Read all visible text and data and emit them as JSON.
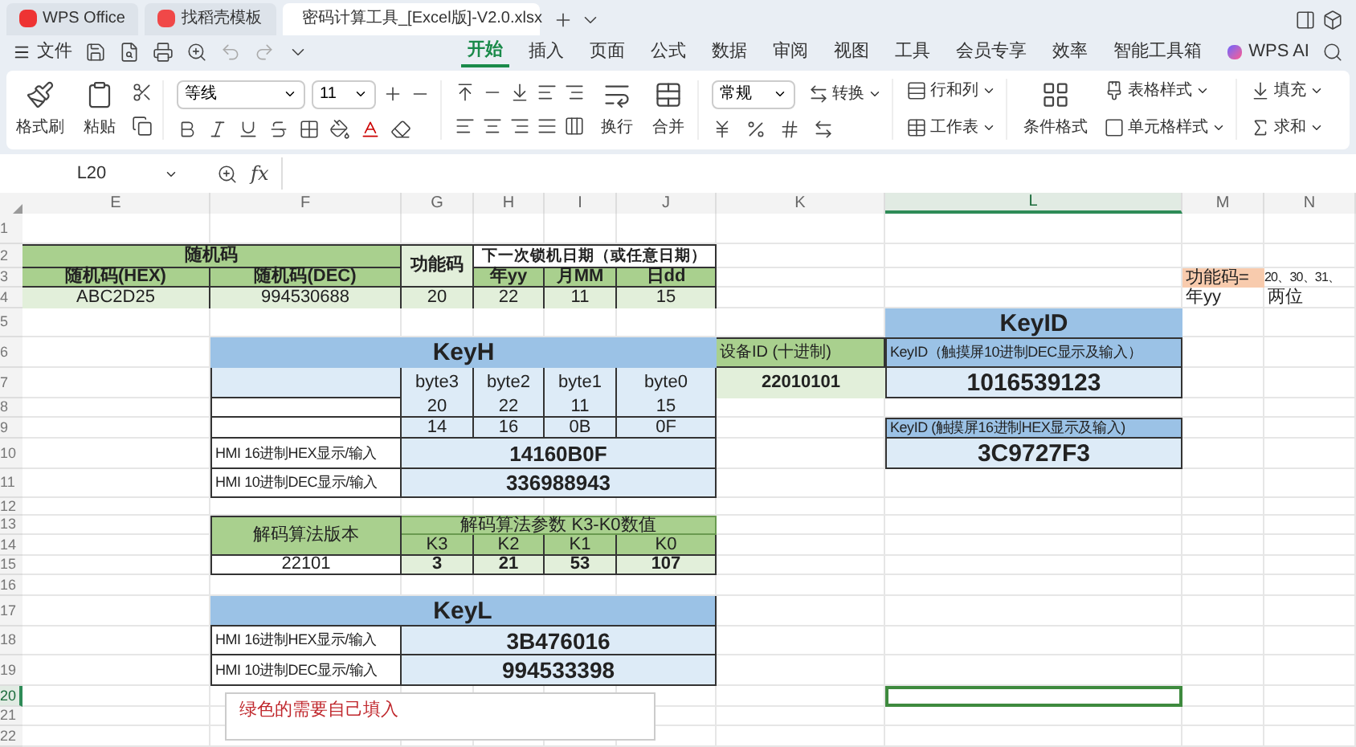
{
  "tabs": [
    {
      "label": "WPS Office",
      "selected": false
    },
    {
      "label": "找稻壳模板",
      "selected": false
    },
    {
      "label": "密码计算工具_[Excel版]-V2.0.xlsx",
      "selected": true
    }
  ],
  "menu": {
    "file": "文件",
    "tabs": [
      {
        "label": "开始",
        "selected": true
      },
      {
        "label": "插入",
        "selected": false
      },
      {
        "label": "页面",
        "selected": false
      },
      {
        "label": "公式",
        "selected": false
      },
      {
        "label": "数据",
        "selected": false
      },
      {
        "label": "审阅",
        "selected": false
      },
      {
        "label": "视图",
        "selected": false
      },
      {
        "label": "工具",
        "selected": false
      },
      {
        "label": "会员专享",
        "selected": false
      },
      {
        "label": "效率",
        "selected": false
      },
      {
        "label": "智能工具箱",
        "selected": false
      }
    ],
    "ai": "WPS AI"
  },
  "ribbon": {
    "format_painter": "格式刷",
    "paste": "粘贴",
    "font": "等线",
    "font_size": "11",
    "wrap": "换行",
    "merge": "合并",
    "number_format": "常规",
    "convert": "转换",
    "rows_cols": "行和列",
    "worksheet": "工作表",
    "conditional": "条件格式",
    "table_style": "表格样式",
    "cell_style": "单元格样式",
    "fill": "填充",
    "sum": "求和"
  },
  "formula_bar": {
    "name_box": "L20",
    "fx": "fx"
  },
  "columns": [
    {
      "label": "E",
      "selected": false
    },
    {
      "label": "F",
      "selected": false
    },
    {
      "label": "G",
      "selected": false
    },
    {
      "label": "H",
      "selected": false
    },
    {
      "label": "I",
      "selected": false
    },
    {
      "label": "J",
      "selected": false
    },
    {
      "label": "K",
      "selected": false
    },
    {
      "label": "L",
      "selected": true
    },
    {
      "label": "M",
      "selected": false
    },
    {
      "label": "N",
      "selected": false
    }
  ],
  "rows": [
    {
      "label": "1",
      "selected": false
    },
    {
      "label": "2",
      "selected": false
    },
    {
      "label": "3",
      "selected": false
    },
    {
      "label": "4",
      "selected": false
    },
    {
      "label": "5",
      "selected": false
    },
    {
      "label": "6",
      "selected": false
    },
    {
      "label": "7",
      "selected": false
    },
    {
      "label": "8",
      "selected": false
    },
    {
      "label": "9",
      "selected": false
    },
    {
      "label": "10",
      "selected": false
    },
    {
      "label": "11",
      "selected": false
    },
    {
      "label": "12",
      "selected": false
    },
    {
      "label": "13",
      "selected": false
    },
    {
      "label": "14",
      "selected": false
    },
    {
      "label": "15",
      "selected": false
    },
    {
      "label": "16",
      "selected": false
    },
    {
      "label": "17",
      "selected": false
    },
    {
      "label": "18",
      "selected": false
    },
    {
      "label": "19",
      "selected": false
    },
    {
      "label": "20",
      "selected": true
    },
    {
      "label": "21",
      "selected": false
    },
    {
      "label": "22",
      "selected": false
    }
  ],
  "random_code": {
    "title": "随机码",
    "columns": [
      "随机码(HEX)",
      "随机码(DEC)"
    ],
    "values": [
      "ABC2D25",
      "994530688"
    ]
  },
  "function_code": {
    "label": "功能码",
    "value": "20"
  },
  "lock_date": {
    "title": "下一次锁机日期（或任意日期）",
    "columns": [
      "年yy",
      "月MM",
      "日dd"
    ],
    "values": [
      "22",
      "11",
      "15"
    ]
  },
  "key_h": {
    "title": "KeyH",
    "bytes": [
      "byte3",
      "byte2",
      "byte1",
      "byte0"
    ],
    "decimal": [
      "20",
      "22",
      "11",
      "15"
    ],
    "hex": [
      "14",
      "16",
      "0B",
      "0F"
    ],
    "rows": [
      {
        "label": "HMI 16进制HEX显示/输入",
        "value": "14160B0F"
      },
      {
        "label": "HMI 10进制DEC显示/输入",
        "value": "336988943"
      }
    ]
  },
  "decode": {
    "label": "解码算法版本",
    "version": "22101",
    "title": "解码算法参数 K3-K0数值",
    "columns": [
      "K3",
      "K2",
      "K1",
      "K0"
    ],
    "values": [
      "3",
      "21",
      "53",
      "107"
    ]
  },
  "key_l": {
    "title": "KeyL",
    "rows": [
      {
        "label": "HMI 16进制HEX显示/输入",
        "value": "3B476016"
      },
      {
        "label": "HMI 10进制DEC显示/输入",
        "value": "994533398"
      }
    ]
  },
  "device_id": {
    "label": "设备ID (十进制)",
    "value": "22010101"
  },
  "key_id": {
    "title": "KeyID",
    "rows": [
      {
        "label": "KeyID（触摸屏10进制DEC显示及输入）",
        "value": "1016539123"
      },
      {
        "label": "KeyID (触摸屏16进制HEX显示及输入)",
        "value": "3C9727F3"
      }
    ]
  },
  "notes": [
    {
      "label": "功能码=",
      "value": "20、30、31、"
    },
    {
      "label": "年yy",
      "value": "两位"
    }
  ],
  "text_box": [
    "绿色的需要自己填入"
  ]
}
